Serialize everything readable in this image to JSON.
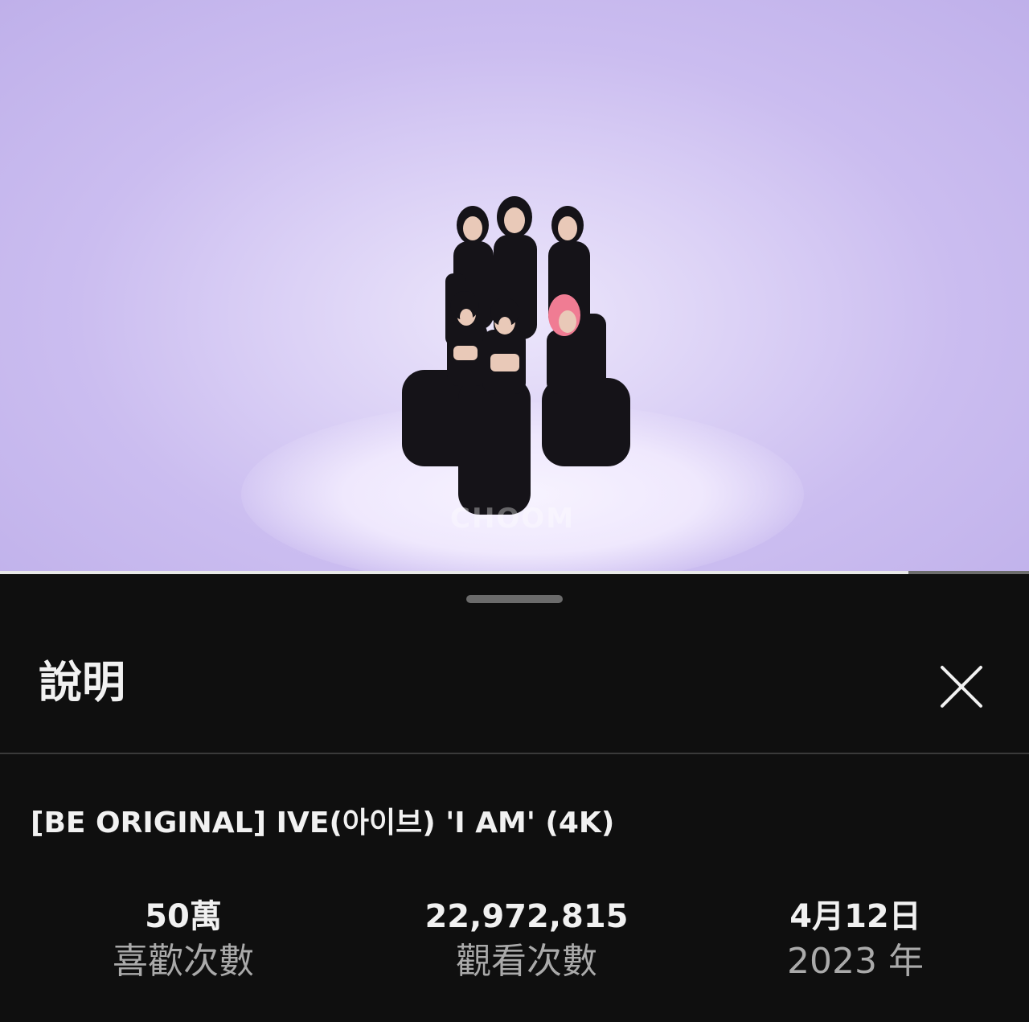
{
  "video": {
    "watermark": "CHOOM",
    "progress": 0.883
  },
  "sheet": {
    "title": "說明",
    "close_icon": "close-icon"
  },
  "video_title": "[BE ORIGINAL] IVE(아이브) 'I AM' (4K)",
  "stats": {
    "likes": {
      "value": "50萬",
      "label": "喜歡次數"
    },
    "views": {
      "value": "22,972,815",
      "label": "觀看次數"
    },
    "date": {
      "value": "4月12日",
      "label": "2023 年"
    }
  },
  "colors": {
    "background": "#0f0f0f",
    "text_primary": "#f1f1f1",
    "text_secondary": "#aaaaaa",
    "video_backdrop": "#cbbdf0"
  }
}
